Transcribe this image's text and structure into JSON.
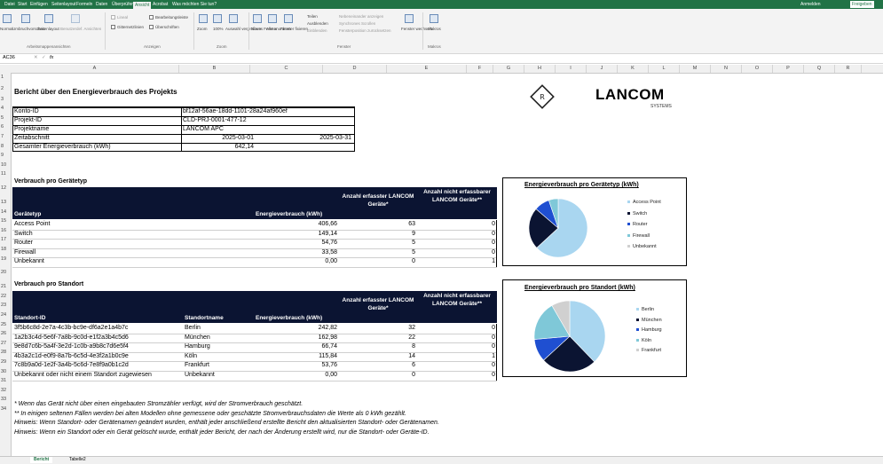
{
  "ribbon_tabs": [
    "Datei",
    "Start",
    "Einfügen",
    "Seitenlayout",
    "Formeln",
    "Daten",
    "Überprüfen",
    "Ansicht",
    "Acrobat",
    "Was möchten Sie tun?"
  ],
  "user": {
    "name": "Anmelden",
    "share": "Freigeben"
  },
  "ribbon": {
    "buttons": [
      "Normal",
      "Umbruchvorschau",
      "Seitenlayout",
      "Benutzerdef. Ansichten",
      "Lineal",
      "Bearbeitungsleiste",
      "Gitternetzlinien",
      "Überschriften",
      "Zoom",
      "100%",
      "Auswahl vergrößern",
      "Neues Fenster",
      "Alle anordnen",
      "Fenster fixieren",
      "Teilen",
      "Ausblenden",
      "Einblenden",
      "Nebeneinander anzeigen",
      "Synchrones Scrollen",
      "Fensterposition zurücksetzen",
      "Fenster wechseln",
      "Makros"
    ],
    "groups": [
      "Arbeitsmappenansichten",
      "Anzeigen",
      "Zoom",
      "Fenster",
      "Makros"
    ]
  },
  "formula_bar": {
    "name_box": "AC36",
    "fx": "fx",
    "value": ""
  },
  "columns": [
    "A",
    "B",
    "C",
    "D",
    "E",
    "F",
    "G",
    "H",
    "I",
    "J",
    "K",
    "L",
    "M",
    "N",
    "O",
    "P",
    "Q",
    "R"
  ],
  "rows": [
    "1",
    "2",
    "3",
    "4",
    "5",
    "6",
    "7",
    "8",
    "9",
    "10",
    "11",
    "12",
    "13",
    "14",
    "15",
    "16",
    "17",
    "18",
    "19",
    "20",
    "21",
    "22",
    "23",
    "24",
    "25",
    "26",
    "27",
    "28",
    "29",
    "30",
    "31",
    "32",
    "33",
    "34"
  ],
  "report_title": "Bericht über den Energieverbrauch des Projekts",
  "logo": {
    "name": "LANCOM",
    "sub": "SYSTEMS"
  },
  "info": [
    {
      "label": "Konto-ID",
      "value": "bf12af-56ae-18dd-1101-28a24af960ef",
      "value2": ""
    },
    {
      "label": "Projekt-ID",
      "value": "CLD-PRJ-0001-477-12",
      "value2": ""
    },
    {
      "label": "Projektname",
      "value": "LANCOM APC",
      "value2": ""
    },
    {
      "label": "Zeitabschnitt",
      "value": "2025-03-01",
      "value2": "2025-03-31"
    },
    {
      "label": "Gesamter Energieverbrauch (kWh)",
      "value": "642,14",
      "value2": ""
    }
  ],
  "device_section": {
    "title": "Verbrauch pro Gerätetyp",
    "headers": [
      "Gerätetyp",
      "",
      "Energieverbrauch (kWh)",
      "Anzahl erfasster LANCOM Geräte*",
      "Anzahl nicht erfassbarer LANCOM Geräte**"
    ],
    "rows": [
      [
        "Access Point",
        "",
        "406,66",
        "63",
        "0"
      ],
      [
        "Switch",
        "",
        "149,14",
        "9",
        "0"
      ],
      [
        "Router",
        "",
        "54,76",
        "5",
        "0"
      ],
      [
        "Firewall",
        "",
        "33,58",
        "5",
        "0"
      ],
      [
        "Unbekannt",
        "",
        "0,00",
        "0",
        "1"
      ]
    ]
  },
  "location_section": {
    "title": "Verbrauch pro Standort",
    "headers": [
      "Standort-ID",
      "Standortname",
      "Energieverbrauch (kWh)",
      "Anzahl erfasster LANCOM Geräte*",
      "Anzahl nicht erfassbarer LANCOM Geräte**"
    ],
    "rows": [
      [
        "3f5b6c8d-2e7a-4c3b-bc9e-df6a2e1a4b7c",
        "Berlin",
        "242,82",
        "32",
        "0"
      ],
      [
        "1a2b3c4d-5e6f-7a8b-9c0d-e1f2a3b4c5d6",
        "München",
        "162,98",
        "22",
        "0"
      ],
      [
        "9e8d7c6b-5a4f-3e2d-1c0b-a9b8c7d6e5f4",
        "Hamburg",
        "66,74",
        "8",
        "0"
      ],
      [
        "4b3a2c1d-e0f9-8a7b-6c5d-4e3f2a1b0c9e",
        "Köln",
        "115,84",
        "14",
        "1"
      ],
      [
        "7c8b9a0d-1e2f-3a4b-5c6d-7e8f9a0b1c2d",
        "Frankfurt",
        "53,76",
        "6",
        "0"
      ],
      [
        "Unbekannt oder nicht einem Standort zugewiesen",
        "Unbekannt",
        "0,00",
        "0",
        "0"
      ]
    ]
  },
  "notes": [
    "* Wenn das Gerät nicht über einen eingebauten Stromzähler verfügt, wird der Stromverbrauch geschätzt.",
    "** In einigen seltenen Fällen werden bei alten Modellen ohne gemessene oder geschätzte Stromverbrauchsdaten die Werte als 0 kWh gezählt.",
    "Hinweis: Wenn Standort- oder Gerätenamen geändert wurden, enthält jeder anschließend erstellte Bericht den aktualisierten Standort- oder Gerätenamen.",
    "Hinweis: Wenn ein Standort oder ein Gerät gelöscht wurde, enthält jeder Bericht, der nach der Änderung erstellt wird, nur die Standort- oder Geräte-ID."
  ],
  "chart_data": [
    {
      "type": "pie",
      "title": "Energieverbrauch pro Gerätetyp (kWh)",
      "categories": [
        "Access Point",
        "Switch",
        "Router",
        "Firewall",
        "Unbekannt"
      ],
      "values": [
        406.66,
        149.14,
        54.76,
        33.58,
        0.0
      ],
      "colors": [
        "#a9d6f0",
        "#0b1432",
        "#1f4fd1",
        "#7fc8d8",
        "#d0d0d0"
      ],
      "legend": "right"
    },
    {
      "type": "pie",
      "title": "Energieverbrauch pro Standort (kWh)",
      "categories": [
        "Berlin",
        "München",
        "Hamburg",
        "Köln",
        "Frankfurt"
      ],
      "values": [
        242.82,
        162.98,
        66.74,
        115.84,
        53.76
      ],
      "colors": [
        "#a9d6f0",
        "#0b1432",
        "#1f4fd1",
        "#7fc8d8",
        "#d0d0d0"
      ],
      "legend": "right"
    }
  ],
  "sheet_tabs": [
    "Bericht",
    "Tabelle2"
  ]
}
